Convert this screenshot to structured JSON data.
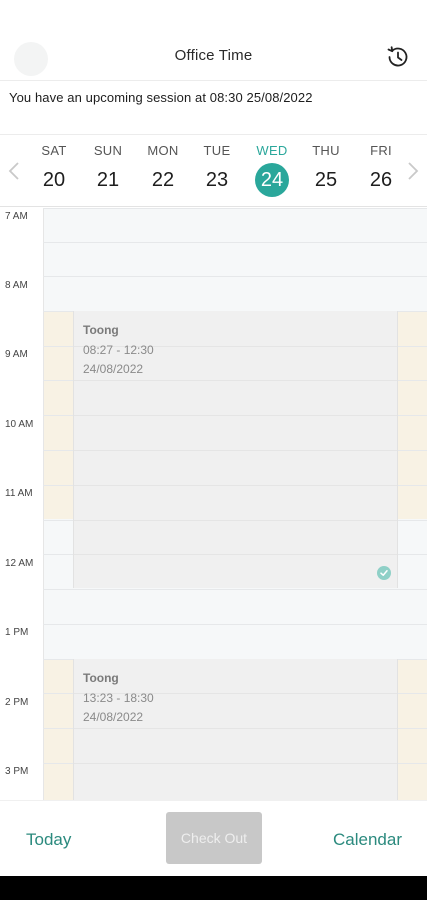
{
  "header": {
    "title": "Office Time",
    "history_icon": "history-clock-icon"
  },
  "notice": {
    "text": "You have an upcoming session at 08:30 25/08/2022"
  },
  "week": {
    "days": [
      {
        "name": "SAT",
        "num": "20",
        "selected": false
      },
      {
        "name": "SUN",
        "num": "21",
        "selected": false
      },
      {
        "name": "MON",
        "num": "22",
        "selected": false
      },
      {
        "name": "TUE",
        "num": "23",
        "selected": false
      },
      {
        "name": "WED",
        "num": "24",
        "selected": true
      },
      {
        "name": "THU",
        "num": "25",
        "selected": false
      },
      {
        "name": "FRI",
        "num": "26",
        "selected": false
      }
    ],
    "prev_icon": "chevron-left-icon",
    "next_icon": "chevron-right-icon",
    "selected_color": "#2aa79b"
  },
  "timeline": {
    "hours": [
      "7 AM",
      "8 AM",
      "9 AM",
      "10 AM",
      "11 AM",
      "12 AM",
      "1 PM",
      "2 PM",
      "3 PM"
    ]
  },
  "events": [
    {
      "name": "Toong",
      "time": "08:27 - 12:30",
      "date": "24/08/2022",
      "completed": true
    },
    {
      "name": "Toong",
      "time": "13:23 - 18:30",
      "date": "24/08/2022",
      "completed": false
    }
  ],
  "bottom": {
    "today_label": "Today",
    "checkout_label": "Check Out",
    "calendar_label": "Calendar",
    "accent": "#2b8a7e"
  }
}
